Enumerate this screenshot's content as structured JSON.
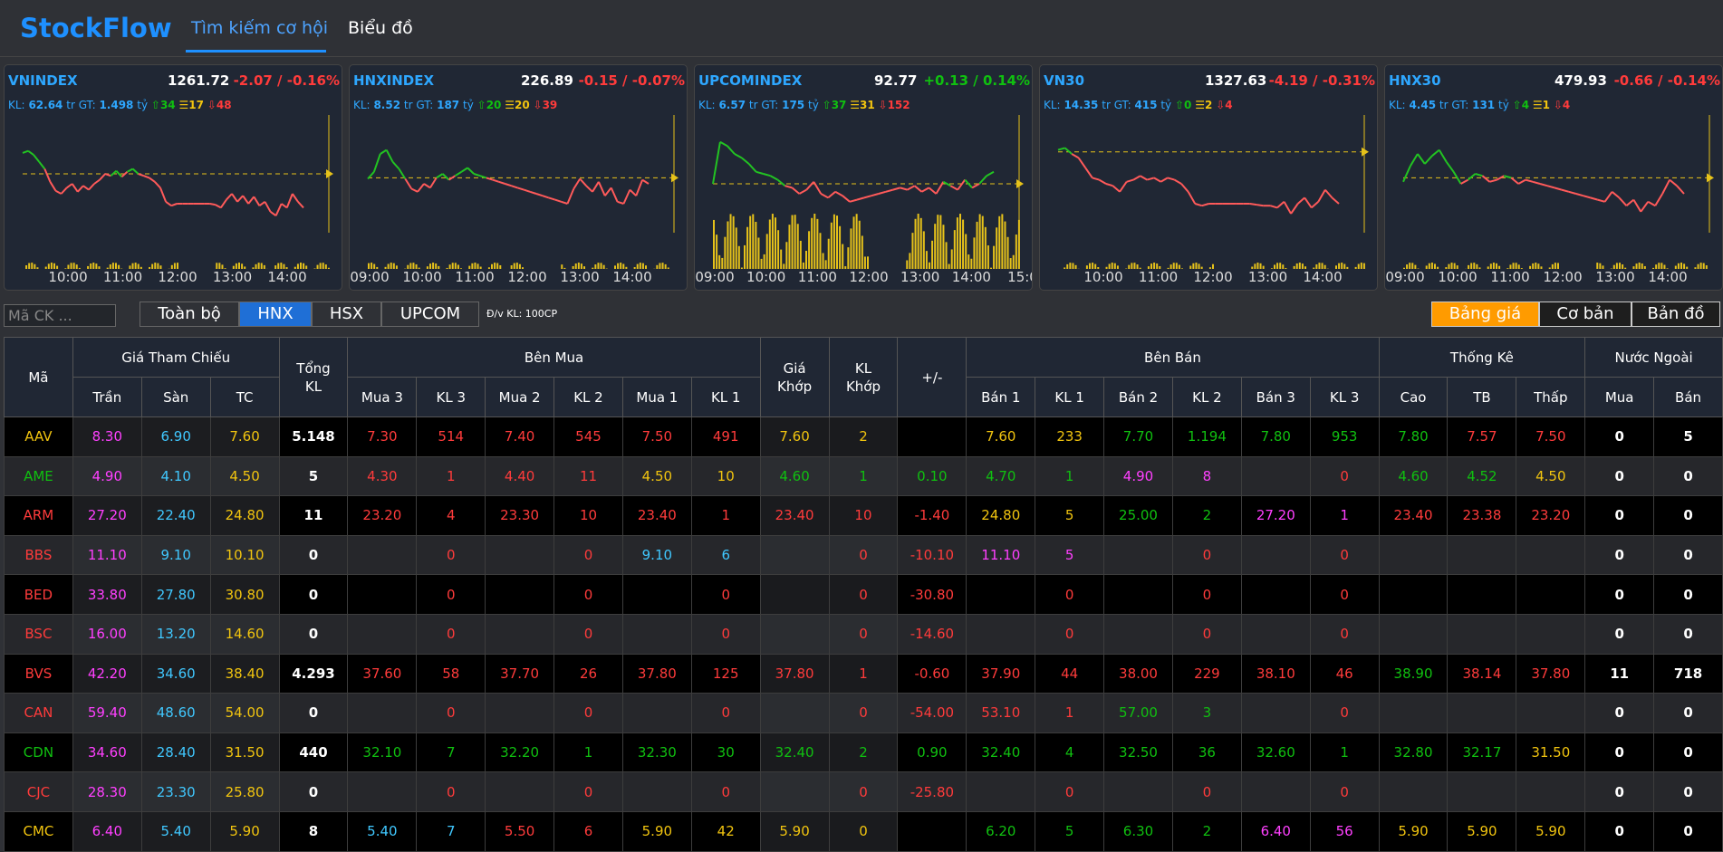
{
  "app": {
    "brand": "StockFlow",
    "tabs": [
      "Tìm kiếm cơ hội",
      "Biểu đồ"
    ]
  },
  "colors": {
    "up": "#10c010",
    "down": "#ff3b3b",
    "ref": "#f1c40f",
    "ceil": "#ff40ff",
    "floor": "#40c8ff",
    "accent": "#1e90ff"
  },
  "indices": [
    {
      "name": "VNINDEX",
      "value": "1261.72",
      "change": "-2.07 / -0.16%",
      "dir": "down",
      "kl_label": "KL:",
      "kl": "62.64",
      "gt_label": "tr GT:",
      "gt": "1.498",
      "gt_unit": "tỷ",
      "adv": "34",
      "unch": "17",
      "dec": "48",
      "times": [
        "10:00",
        "11:00",
        "12:00",
        "13:00",
        "14:00"
      ],
      "chart_data": {
        "type": "line",
        "ref": 0.5,
        "price": [
          0.71,
          0.73,
          0.69,
          0.62,
          0.55,
          0.42,
          0.33,
          0.3,
          0.36,
          0.4,
          0.32,
          0.38,
          0.34,
          0.4,
          0.44,
          0.5,
          0.48,
          0.53,
          0.47,
          0.52,
          0.55,
          0.5,
          0.48,
          0.46,
          0.42,
          0.36,
          0.22,
          0.18,
          0.2,
          0.2,
          0.2,
          0.2,
          0.2,
          0.2,
          0.2,
          0.19,
          0.16,
          0.24,
          0.3,
          0.22,
          0.28,
          0.2,
          0.27,
          0.18,
          0.22,
          0.12,
          0.08,
          0.2,
          0.16,
          0.3,
          0.22,
          0.16
        ]
      }
    },
    {
      "name": "HNXINDEX",
      "value": "226.89",
      "change": "-0.15 / -0.07%",
      "dir": "down",
      "kl_label": "KL:",
      "kl": "8.52",
      "gt_label": "tr GT:",
      "gt": "187",
      "gt_unit": "tỷ",
      "adv": "20",
      "unch": "20",
      "dec": "39",
      "times": [
        "09:00",
        "10:00",
        "11:00",
        "12:00",
        "13:00",
        "14:00"
      ],
      "chart_data": {
        "type": "line",
        "ref": 0.46,
        "price": [
          0.45,
          0.52,
          0.7,
          0.74,
          0.62,
          0.55,
          0.45,
          0.35,
          0.32,
          0.4,
          0.36,
          0.46,
          0.5,
          0.44,
          0.48,
          0.52,
          0.56,
          0.5,
          0.48,
          0.46,
          0.44,
          0.42,
          0.4,
          0.38,
          0.36,
          0.34,
          0.32,
          0.3,
          0.28,
          0.26,
          0.24,
          0.22,
          0.2,
          0.35,
          0.45,
          0.38,
          0.32,
          0.42,
          0.28,
          0.36,
          0.22,
          0.2,
          0.34,
          0.28,
          0.44,
          0.4
        ]
      }
    },
    {
      "name": "UPCOMINDEX",
      "value": "92.77",
      "change": "+0.13 / 0.14%",
      "dir": "up",
      "kl_label": "KL:",
      "kl": "6.57",
      "gt_label": "tr GT:",
      "gt": "175",
      "gt_unit": "tỷ",
      "adv": "37",
      "unch": "31",
      "dec": "152",
      "times": [
        "09:00",
        "10:00",
        "11:00",
        "12:00",
        "13:00",
        "14:00",
        "15:0"
      ],
      "chart_data": {
        "type": "line",
        "ref": 0.4,
        "price": [
          0.4,
          0.82,
          0.78,
          0.7,
          0.66,
          0.6,
          0.52,
          0.5,
          0.48,
          0.44,
          0.38,
          0.36,
          0.3,
          0.34,
          0.42,
          0.3,
          0.26,
          0.32,
          0.28,
          0.22,
          0.24,
          0.26,
          0.28,
          0.3,
          0.32,
          0.34,
          0.36,
          0.34,
          0.38,
          0.32,
          0.36,
          0.3,
          0.42,
          0.38,
          0.34,
          0.44,
          0.36,
          0.4,
          0.48,
          0.52
        ]
      }
    },
    {
      "name": "VN30",
      "value": "1327.63",
      "change": "-4.19 / -0.31%",
      "dir": "down",
      "kl_label": "KL:",
      "kl": "14.35",
      "gt_label": "tr GT:",
      "gt": "415",
      "gt_unit": "tỷ",
      "adv": "0",
      "unch": "2",
      "dec": "4",
      "times": [
        "10:00",
        "11:00",
        "12:00",
        "13:00",
        "14:00"
      ],
      "chart_data": {
        "type": "line",
        "ref": 0.72,
        "price": [
          0.74,
          0.76,
          0.7,
          0.66,
          0.56,
          0.46,
          0.44,
          0.4,
          0.38,
          0.32,
          0.42,
          0.44,
          0.48,
          0.44,
          0.46,
          0.42,
          0.46,
          0.44,
          0.4,
          0.32,
          0.2,
          0.18,
          0.2,
          0.2,
          0.2,
          0.2,
          0.2,
          0.2,
          0.2,
          0.19,
          0.18,
          0.18,
          0.16,
          0.22,
          0.1,
          0.2,
          0.26,
          0.16,
          0.22,
          0.34,
          0.26,
          0.2
        ]
      }
    },
    {
      "name": "HNX30",
      "value": "479.93",
      "change": "-0.66 / -0.14%",
      "dir": "down",
      "kl_label": "KL:",
      "kl": "4.45",
      "gt_label": "tr GT:",
      "gt": "131",
      "gt_unit": "tỷ",
      "adv": "4",
      "unch": "1",
      "dec": "4",
      "times": [
        "09:00",
        "10:00",
        "11:00",
        "12:00",
        "13:00",
        "14:00"
      ],
      "chart_data": {
        "type": "line",
        "ref": 0.46,
        "price": [
          0.42,
          0.58,
          0.7,
          0.6,
          0.68,
          0.74,
          0.62,
          0.52,
          0.4,
          0.44,
          0.5,
          0.48,
          0.42,
          0.44,
          0.48,
          0.46,
          0.4,
          0.44,
          0.42,
          0.4,
          0.38,
          0.36,
          0.34,
          0.32,
          0.3,
          0.28,
          0.26,
          0.24,
          0.22,
          0.32,
          0.26,
          0.18,
          0.24,
          0.12,
          0.22,
          0.18,
          0.3,
          0.44,
          0.38,
          0.3
        ]
      }
    }
  ],
  "filter": {
    "search_placeholder": "Mã CK ...",
    "exchanges": [
      "Toàn bộ",
      "HNX",
      "HSX",
      "UPCOM"
    ],
    "unit": "Đ/v KL: 100CP",
    "views": [
      "Bảng giá",
      "Cơ bản",
      "Bản đồ"
    ]
  },
  "table": {
    "groups": {
      "ma": "Mã",
      "ref": "Giá Tham Chiếu",
      "tong": "Tổng KL",
      "buy": "Bên Mua",
      "gia_khop": "Giá Khớp",
      "kl_khop": "KL Khớp",
      "chg": "+/-",
      "sell": "Bên Bán",
      "stat": "Thống Kê",
      "foreign": "Nước Ngoài"
    },
    "sub": [
      "Trần",
      "Sàn",
      "TC",
      "Mua 3",
      "KL 3",
      "Mua 2",
      "KL 2",
      "Mua 1",
      "KL 1",
      "Bán 1",
      "KL 1",
      "Bán 2",
      "KL 2",
      "Bán 3",
      "KL 3",
      "Cao",
      "TB",
      "Thấp",
      "Mua",
      "Bán"
    ],
    "rows": [
      {
        "v": [
          "AAV",
          "8.30",
          "6.90",
          "7.60",
          "5.148",
          "7.30",
          "514",
          "7.40",
          "545",
          "7.50",
          "491",
          "7.60",
          "2",
          "",
          "7.60",
          "233",
          "7.70",
          "1.194",
          "7.80",
          "953",
          "7.80",
          "7.57",
          "7.50",
          "0",
          "5"
        ],
        "c": [
          "y",
          "p",
          "c",
          "y",
          "w",
          "r",
          "r",
          "r",
          "r",
          "r",
          "r",
          "y",
          "y",
          "",
          "y",
          "y",
          "g",
          "g",
          "g",
          "g",
          "g",
          "r",
          "r",
          "w",
          "w"
        ]
      },
      {
        "v": [
          "AME",
          "4.90",
          "4.10",
          "4.50",
          "5",
          "4.30",
          "1",
          "4.40",
          "11",
          "4.50",
          "10",
          "4.60",
          "1",
          "0.10",
          "4.70",
          "1",
          "4.90",
          "8",
          "",
          "0",
          "4.60",
          "4.52",
          "4.50",
          "0",
          "0"
        ],
        "c": [
          "g",
          "p",
          "c",
          "y",
          "w",
          "r",
          "r",
          "r",
          "r",
          "y",
          "y",
          "g",
          "g",
          "g",
          "g",
          "g",
          "p",
          "p",
          "",
          "r",
          "g",
          "g",
          "y",
          "w",
          "w"
        ]
      },
      {
        "v": [
          "ARM",
          "27.20",
          "22.40",
          "24.80",
          "11",
          "23.20",
          "4",
          "23.30",
          "10",
          "23.40",
          "1",
          "23.40",
          "10",
          "-1.40",
          "24.80",
          "5",
          "25.00",
          "2",
          "27.20",
          "1",
          "23.40",
          "23.38",
          "23.20",
          "0",
          "0"
        ],
        "c": [
          "r",
          "p",
          "c",
          "y",
          "w",
          "r",
          "r",
          "r",
          "r",
          "r",
          "r",
          "r",
          "r",
          "r",
          "y",
          "y",
          "g",
          "g",
          "p",
          "p",
          "r",
          "r",
          "r",
          "w",
          "w"
        ]
      },
      {
        "v": [
          "BBS",
          "11.10",
          "9.10",
          "10.10",
          "0",
          "",
          "0",
          "",
          "0",
          "9.10",
          "6",
          "",
          "0",
          "-10.10",
          "11.10",
          "5",
          "",
          "0",
          "",
          "0",
          "",
          "",
          "",
          "0",
          "0"
        ],
        "c": [
          "r",
          "p",
          "c",
          "y",
          "w",
          "",
          "r",
          "",
          "r",
          "c",
          "c",
          "",
          "r",
          "r",
          "p",
          "p",
          "",
          "r",
          "",
          "r",
          "",
          "",
          "",
          "w",
          "w"
        ]
      },
      {
        "v": [
          "BED",
          "33.80",
          "27.80",
          "30.80",
          "0",
          "",
          "0",
          "",
          "0",
          "",
          "0",
          "",
          "0",
          "-30.80",
          "",
          "0",
          "",
          "0",
          "",
          "0",
          "",
          "",
          "",
          "0",
          "0"
        ],
        "c": [
          "r",
          "p",
          "c",
          "y",
          "w",
          "",
          "r",
          "",
          "r",
          "",
          "r",
          "",
          "r",
          "r",
          "",
          "r",
          "",
          "r",
          "",
          "r",
          "",
          "",
          "",
          "w",
          "w"
        ]
      },
      {
        "v": [
          "BSC",
          "16.00",
          "13.20",
          "14.60",
          "0",
          "",
          "0",
          "",
          "0",
          "",
          "0",
          "",
          "0",
          "-14.60",
          "",
          "0",
          "",
          "0",
          "",
          "0",
          "",
          "",
          "",
          "0",
          "0"
        ],
        "c": [
          "r",
          "p",
          "c",
          "y",
          "w",
          "",
          "r",
          "",
          "r",
          "",
          "r",
          "",
          "r",
          "r",
          "",
          "r",
          "",
          "r",
          "",
          "r",
          "",
          "",
          "",
          "w",
          "w"
        ]
      },
      {
        "v": [
          "BVS",
          "42.20",
          "34.60",
          "38.40",
          "4.293",
          "37.60",
          "58",
          "37.70",
          "26",
          "37.80",
          "125",
          "37.80",
          "1",
          "-0.60",
          "37.90",
          "44",
          "38.00",
          "229",
          "38.10",
          "46",
          "38.90",
          "38.14",
          "37.80",
          "11",
          "718"
        ],
        "c": [
          "r",
          "p",
          "c",
          "y",
          "w",
          "r",
          "r",
          "r",
          "r",
          "r",
          "r",
          "r",
          "r",
          "r",
          "r",
          "r",
          "r",
          "r",
          "r",
          "r",
          "g",
          "r",
          "r",
          "w",
          "w"
        ]
      },
      {
        "v": [
          "CAN",
          "59.40",
          "48.60",
          "54.00",
          "0",
          "",
          "0",
          "",
          "0",
          "",
          "0",
          "",
          "0",
          "-54.00",
          "53.10",
          "1",
          "57.00",
          "3",
          "",
          "0",
          "",
          "",
          "",
          "0",
          "0"
        ],
        "c": [
          "r",
          "p",
          "c",
          "y",
          "w",
          "",
          "r",
          "",
          "r",
          "",
          "r",
          "",
          "r",
          "r",
          "r",
          "r",
          "g",
          "g",
          "",
          "r",
          "",
          "",
          "",
          "w",
          "w"
        ]
      },
      {
        "v": [
          "CDN",
          "34.60",
          "28.40",
          "31.50",
          "440",
          "32.10",
          "7",
          "32.20",
          "1",
          "32.30",
          "30",
          "32.40",
          "2",
          "0.90",
          "32.40",
          "4",
          "32.50",
          "36",
          "32.60",
          "1",
          "32.80",
          "32.17",
          "31.50",
          "0",
          "0"
        ],
        "c": [
          "g",
          "p",
          "c",
          "y",
          "w",
          "g",
          "g",
          "g",
          "g",
          "g",
          "g",
          "g",
          "g",
          "g",
          "g",
          "g",
          "g",
          "g",
          "g",
          "g",
          "g",
          "g",
          "y",
          "w",
          "w"
        ]
      },
      {
        "v": [
          "CJC",
          "28.30",
          "23.30",
          "25.80",
          "0",
          "",
          "0",
          "",
          "0",
          "",
          "0",
          "",
          "0",
          "-25.80",
          "",
          "0",
          "",
          "0",
          "",
          "0",
          "",
          "",
          "",
          "0",
          "0"
        ],
        "c": [
          "r",
          "p",
          "c",
          "y",
          "w",
          "",
          "r",
          "",
          "r",
          "",
          "r",
          "",
          "r",
          "r",
          "",
          "r",
          "",
          "r",
          "",
          "r",
          "",
          "",
          "",
          "w",
          "w"
        ]
      },
      {
        "v": [
          "CMC",
          "6.40",
          "5.40",
          "5.90",
          "8",
          "5.40",
          "7",
          "5.50",
          "6",
          "5.90",
          "42",
          "5.90",
          "0",
          "",
          "6.20",
          "5",
          "6.30",
          "2",
          "6.40",
          "56",
          "5.90",
          "5.90",
          "5.90",
          "0",
          "0"
        ],
        "c": [
          "y",
          "p",
          "c",
          "y",
          "w",
          "c",
          "c",
          "r",
          "r",
          "y",
          "y",
          "y",
          "y",
          "",
          "g",
          "g",
          "g",
          "g",
          "p",
          "p",
          "y",
          "y",
          "y",
          "w",
          "w"
        ]
      }
    ]
  }
}
